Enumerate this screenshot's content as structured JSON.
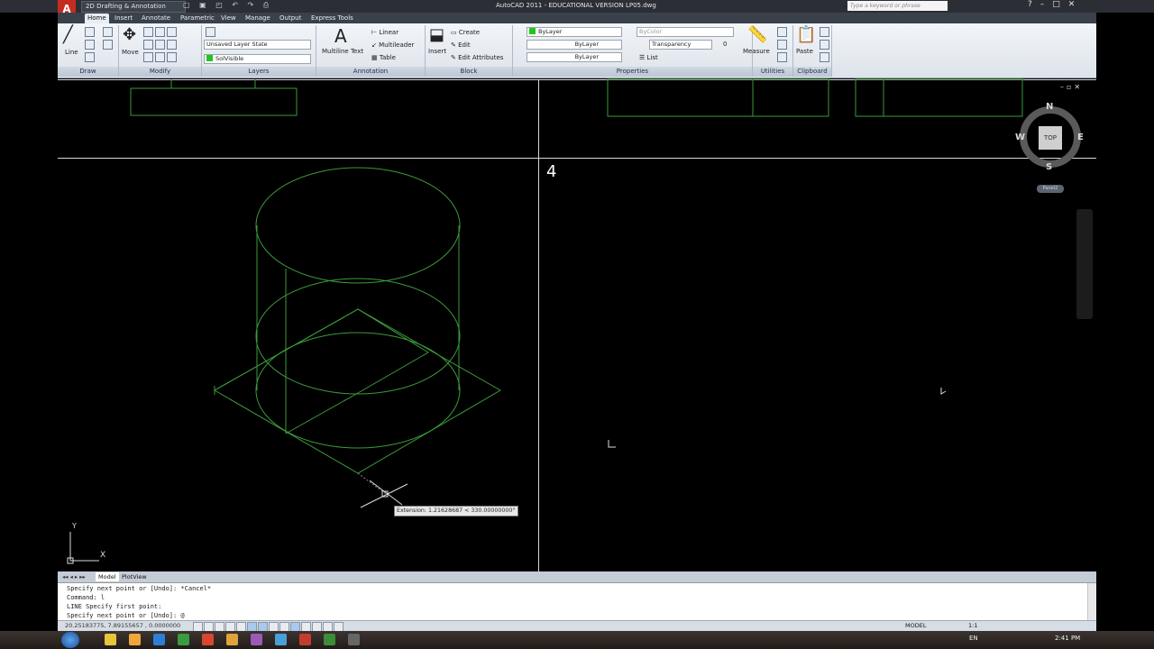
{
  "title_bar": {
    "logo_letter": "A",
    "workspace": "2D Drafting & Annotation",
    "app_title": "AutoCAD 2011 - EDUCATIONAL VERSION    LP05.dwg",
    "search_placeholder": "Type a keyword or phrase",
    "icons": [
      "new-icon",
      "open-icon",
      "save-icon",
      "undo-icon",
      "redo-icon",
      "plot-icon"
    ]
  },
  "ribbon_tabs": [
    "Home",
    "Insert",
    "Annotate",
    "Parametric",
    "View",
    "Manage",
    "Output",
    "Express Tools"
  ],
  "active_tab": "Home",
  "ribbon": {
    "draw": {
      "title": "Draw",
      "line_label": "Line"
    },
    "modify": {
      "title": "Modify",
      "move_label": "Move"
    },
    "layers": {
      "title": "Layers",
      "layer_state": "Unsaved Layer State",
      "layer_name": "SolVisible"
    },
    "annotation": {
      "title": "Annotation",
      "multiline_text": "Multiline Text",
      "linear": "Linear",
      "multileader": "Multileader",
      "table": "Table"
    },
    "block": {
      "title": "Block",
      "insert": "Insert",
      "create": "Create",
      "edit": "Edit",
      "edit_attributes": "Edit Attributes"
    },
    "properties": {
      "title": "Properties",
      "color": "ByLayer",
      "lineweight": "ByLayer",
      "linetype": "ByLayer",
      "plot_style": "ByColor",
      "transparency_label": "Transparency",
      "transparency_value": "0",
      "list": "List"
    },
    "utilities": {
      "title": "Utilities",
      "measure": "Measure"
    },
    "clipboard": {
      "title": "Clipboard",
      "paste": "Paste"
    }
  },
  "viewport": {
    "active_number": "4",
    "viewcube_top": "TOP",
    "compass": {
      "n": "N",
      "s": "S",
      "e": "E",
      "w": "W"
    },
    "wcs_badge": "Panel2",
    "ucs_x": "X",
    "ucs_y": "Y",
    "tooltip": "Extension: 1.21628687 < 330.00000000°"
  },
  "layout_tabs": [
    "Model",
    "PlotView"
  ],
  "command_lines": [
    "Specify next point or [Undo]: *Cancel*",
    "Command: l",
    "LINE Specify first point:",
    "Specify next point or [Undo]: @"
  ],
  "status": {
    "coordinates": "20.25183775, 7.89155657 , 0.0000000",
    "model_label": "MODEL",
    "annotation_scale": "1:1"
  },
  "taskbar": {
    "language": "EN",
    "time": "2:41 PM",
    "icon_colors": [
      "#e8c43a",
      "#f0a63b",
      "#2d7fd3",
      "#3b9b3e",
      "#d8462f",
      "#e0a23a",
      "#9c5ab5",
      "#4aa0d8",
      "#c33d2f",
      "#3d8c39",
      "#666666"
    ]
  },
  "colors": {
    "accent": "#1fc61f",
    "wireframe": "#3a9a3a",
    "tab_bar": "#3a414b",
    "title_bar": "#2b2f35"
  }
}
